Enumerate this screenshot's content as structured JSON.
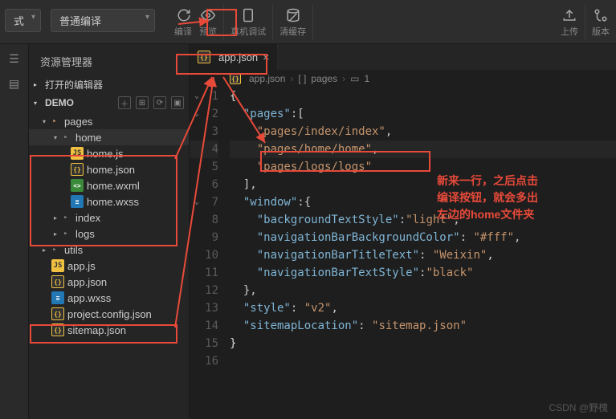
{
  "toolbar": {
    "mode_dropdown_suffix": "式",
    "compile_dropdown": "普通编译",
    "compile_label": "编译",
    "preview_label": "预览",
    "remote_debug_label": "真机调试",
    "clear_cache_label": "清缓存",
    "upload_label": "上传",
    "version_label": "版本"
  },
  "sidebar": {
    "title": "资源管理器",
    "open_editors": "打开的编辑器",
    "project_name": "DEMO",
    "tree": {
      "pages": "pages",
      "home": "home",
      "home_js": "home.js",
      "home_json": "home.json",
      "home_wxml": "home.wxml",
      "home_wxss": "home.wxss",
      "index": "index",
      "logs": "logs",
      "utils": "utils",
      "app_js": "app.js",
      "app_json": "app.json",
      "app_wxss": "app.wxss",
      "project_config": "project.config.json",
      "sitemap": "sitemap.json"
    }
  },
  "editor": {
    "tab_label": "app.json",
    "breadcrumb": {
      "file": "app.json",
      "key": "pages",
      "index": "1"
    },
    "code": {
      "l2_key": "\"pages\"",
      "l3": "\"pages/index/index\"",
      "l4": "\"pages/home/home\"",
      "l5": "\"pages/logs/logs\"",
      "l7_key": "\"window\"",
      "l8_k": "\"backgroundTextStyle\"",
      "l8_v": "\"light\"",
      "l9_k": "\"navigationBarBackgroundColor\"",
      "l9_v": "\"#fff\"",
      "l10_k": "\"navigationBarTitleText\"",
      "l10_v": "\"Weixin\"",
      "l11_k": "\"navigationBarTextStyle\"",
      "l11_v": "\"black\"",
      "l13_k": "\"style\"",
      "l13_v": "\"v2\"",
      "l14_k": "\"sitemapLocation\"",
      "l14_v": "\"sitemap.json\""
    }
  },
  "annotation": {
    "line1": "新来一行，之后点击",
    "line2": "编译按钮，就会多出",
    "line3": "左边的home文件夹"
  },
  "watermark": "CSDN @野槐"
}
